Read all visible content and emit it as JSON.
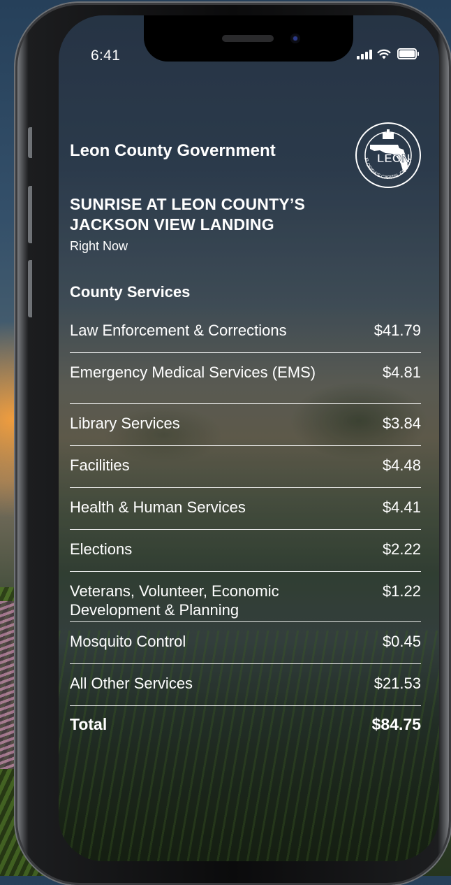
{
  "status_bar": {
    "time": "6:41"
  },
  "header": {
    "org_name": "Leon County Government",
    "headline": "SUNRISE AT LEON COUNTY’S JACKSON VIEW LANDING",
    "subhead": "Right Now",
    "seal": {
      "center_text": "LEON",
      "ring_text": "FLORIDA'S CAPITAL COUNTY"
    }
  },
  "services": {
    "title": "County Services",
    "items": [
      {
        "label": "Law Enforcement & Corrections",
        "amount": "$41.79"
      },
      {
        "label": "Emergency Medical Services (EMS)",
        "amount": "$4.81"
      },
      {
        "label": "Library Services",
        "amount": "$3.84"
      },
      {
        "label": "Facilities",
        "amount": "$4.48"
      },
      {
        "label": "Health & Human Services",
        "amount": "$4.41"
      },
      {
        "label": "Elections",
        "amount": "$2.22"
      },
      {
        "label": "Veterans, Volunteer, Economic Development & Planning",
        "amount": "$1.22"
      },
      {
        "label": "Mosquito Control",
        "amount": "$0.45"
      },
      {
        "label": "All Other Services",
        "amount": "$21.53"
      }
    ],
    "total": {
      "label": "Total",
      "amount": "$84.75"
    }
  },
  "icons": [
    "signal-icon",
    "wifi-icon",
    "battery-icon",
    "leon-county-seal-icon"
  ]
}
